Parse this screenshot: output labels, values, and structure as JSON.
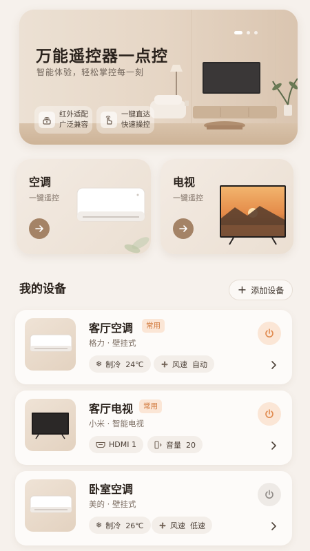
{
  "hero": {
    "title": "万能遥控器一点控",
    "subtitle": "智能体验，轻松掌控每一刻",
    "features": [
      {
        "icon": "wifi-signal-icon",
        "line1": "红外适配",
        "line2": "广泛兼容"
      },
      {
        "icon": "hand-tap-icon",
        "line1": "一键直达",
        "line2": "快速操控"
      }
    ],
    "carousel_total": 3,
    "carousel_active": 1
  },
  "quick": [
    {
      "title": "空调",
      "subtitle": "一键遥控",
      "icon": "arrow-right-icon"
    },
    {
      "title": "电视",
      "subtitle": "一键遥控",
      "icon": "arrow-right-icon"
    }
  ],
  "section": {
    "title": "我的设备",
    "add_label": "添加设备",
    "add_icon": "plus-icon"
  },
  "devices": [
    {
      "name": "客厅空调",
      "tag": "常用",
      "brand": "格力 · 壁挂式",
      "power": "on",
      "chips": [
        {
          "icon": "snowflake-icon",
          "text": "制冷  24℃"
        },
        {
          "icon": "fan-icon",
          "text": "风速  自动"
        }
      ]
    },
    {
      "name": "客厅电视",
      "tag": "常用",
      "brand": "小米 · 智能电视",
      "power": "on",
      "chips": [
        {
          "icon": "hdmi-icon",
          "text": "HDMI 1"
        },
        {
          "icon": "volume-icon",
          "text": "音量  20"
        }
      ]
    },
    {
      "name": "卧室空调",
      "tag": "",
      "brand": "美的 · 壁挂式",
      "power": "off",
      "chips": [
        {
          "icon": "snowflake-icon",
          "text": "制冷  26℃"
        },
        {
          "icon": "fan-icon",
          "text": "风速  低速"
        }
      ]
    }
  ],
  "colors": {
    "background": "#f6f1ec",
    "accent": "#a48366",
    "tag_bg": "#fbe6d6",
    "tag_text": "#d0773a",
    "power_on": "#e08a4e",
    "power_off": "#8f8a86"
  }
}
